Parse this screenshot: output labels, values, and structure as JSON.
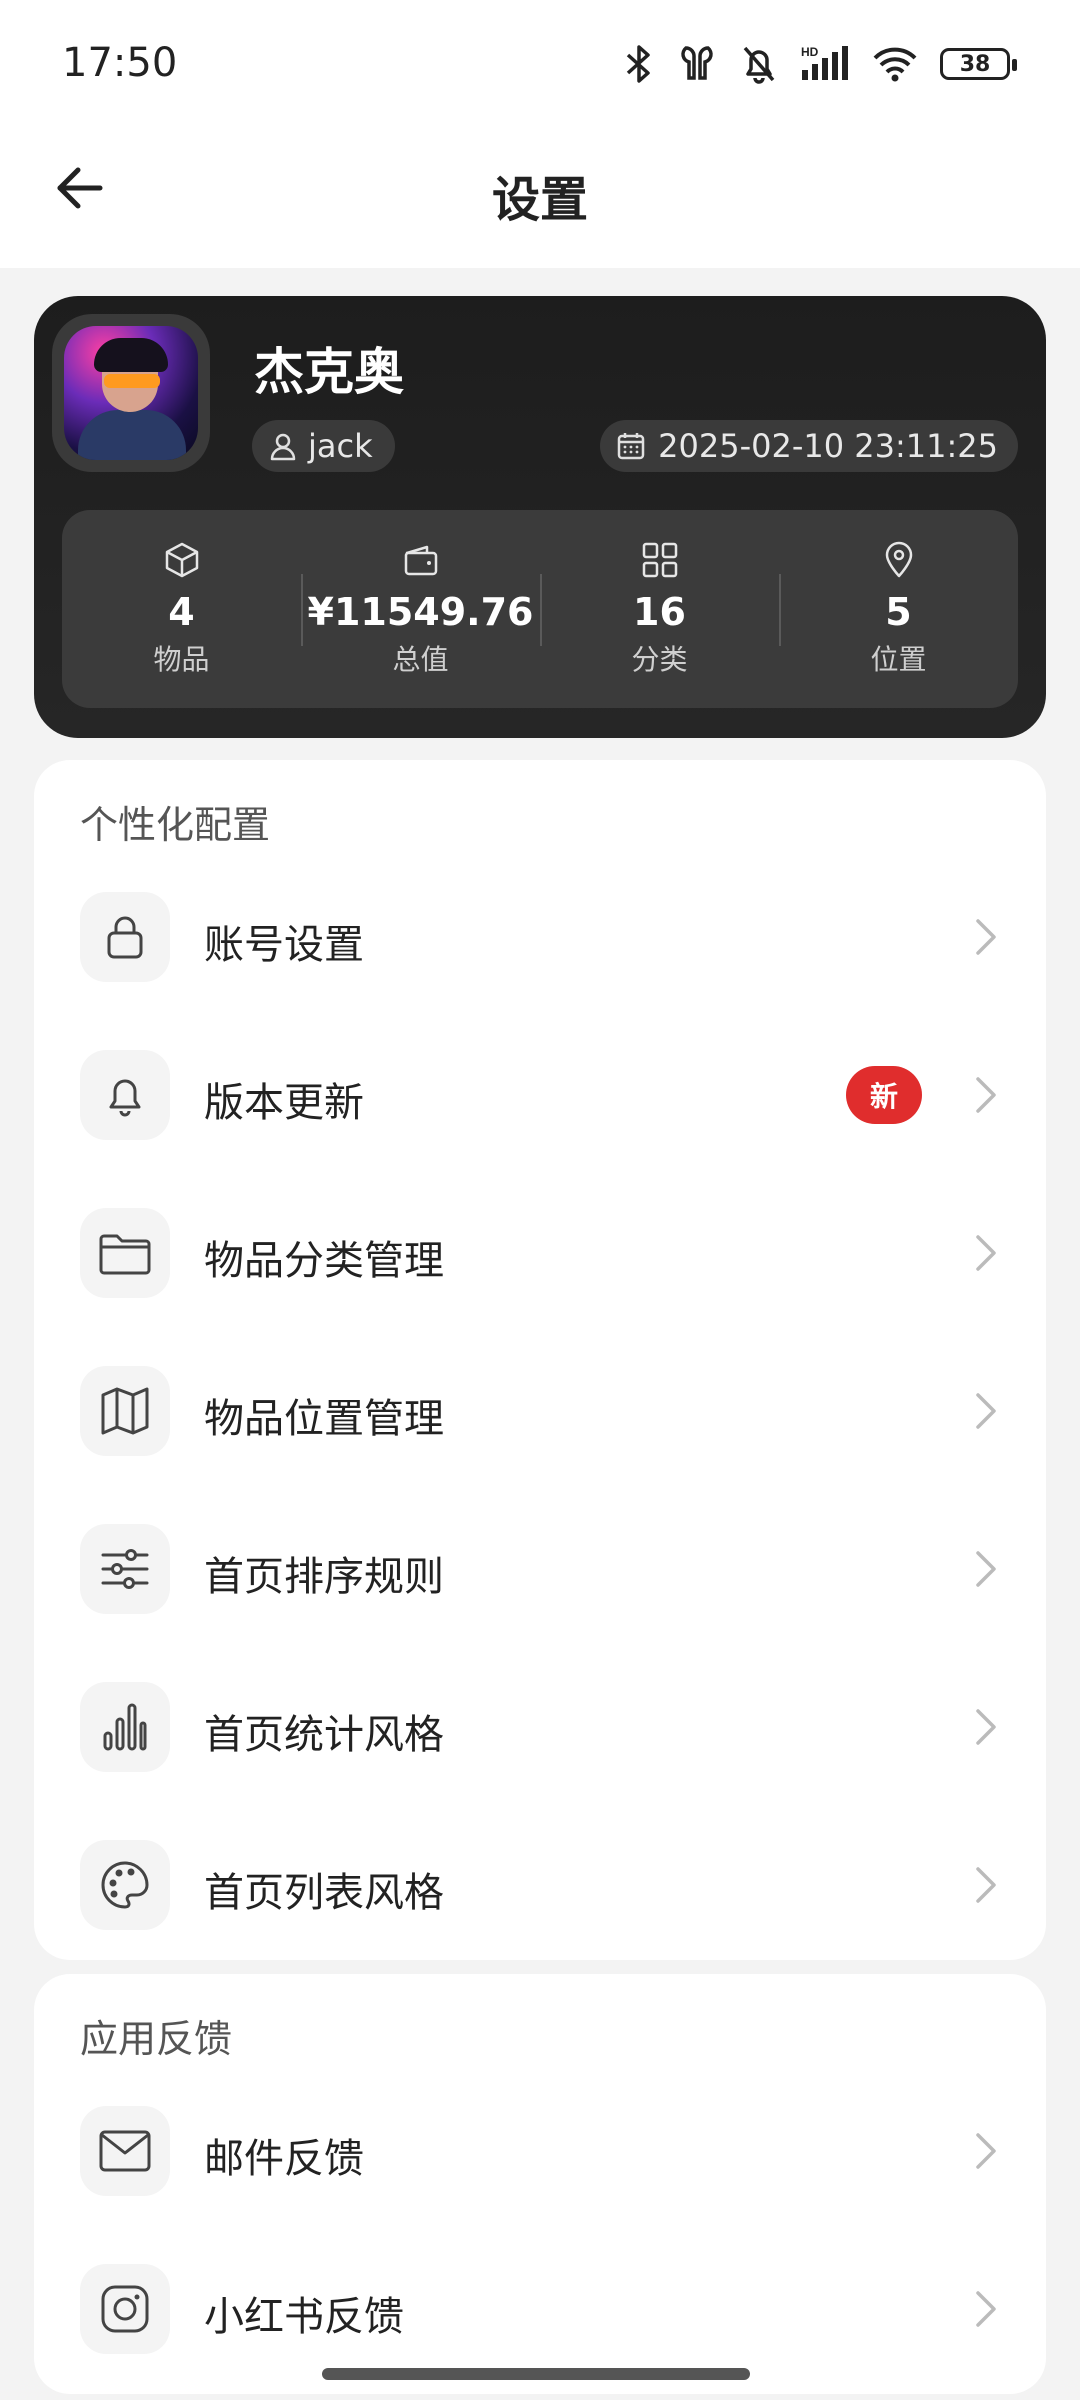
{
  "status_bar": {
    "time": "17:50",
    "battery": "38",
    "icons": [
      "bluetooth-icon",
      "earbuds-icon",
      "mute-bell-icon",
      "signal-hd-icon",
      "wifi-icon",
      "battery-icon"
    ]
  },
  "header": {
    "title": "设置",
    "back_icon": "arrow-left-icon"
  },
  "profile": {
    "name": "杰克奥",
    "username": "jack",
    "joined": "2025-02-10 23:11:25",
    "stats": [
      {
        "icon": "box-icon",
        "value": "4",
        "label": "物品"
      },
      {
        "icon": "wallet-icon",
        "value": "¥11549.76",
        "label": "总值"
      },
      {
        "icon": "grid-icon",
        "value": "16",
        "label": "分类"
      },
      {
        "icon": "location-pin-icon",
        "value": "5",
        "label": "位置"
      }
    ]
  },
  "personalization": {
    "title": "个性化配置",
    "items": [
      {
        "icon": "lock-icon",
        "label": "账号设置"
      },
      {
        "icon": "bell-icon",
        "label": "版本更新",
        "badge": "新"
      },
      {
        "icon": "folder-icon",
        "label": "物品分类管理"
      },
      {
        "icon": "map-icon",
        "label": "物品位置管理"
      },
      {
        "icon": "sliders-icon",
        "label": "首页排序规则"
      },
      {
        "icon": "bar-chart-icon",
        "label": "首页统计风格"
      },
      {
        "icon": "palette-icon",
        "label": "首页列表风格"
      }
    ]
  },
  "feedback": {
    "title": "应用反馈",
    "items": [
      {
        "icon": "mail-icon",
        "label": "邮件反馈"
      },
      {
        "icon": "instagram-icon",
        "label": "小红书反馈"
      }
    ]
  },
  "colors": {
    "accent_badge": "#e02d2d",
    "card_dark": "#1d1d1d",
    "page_bg": "#f3f3f3"
  }
}
